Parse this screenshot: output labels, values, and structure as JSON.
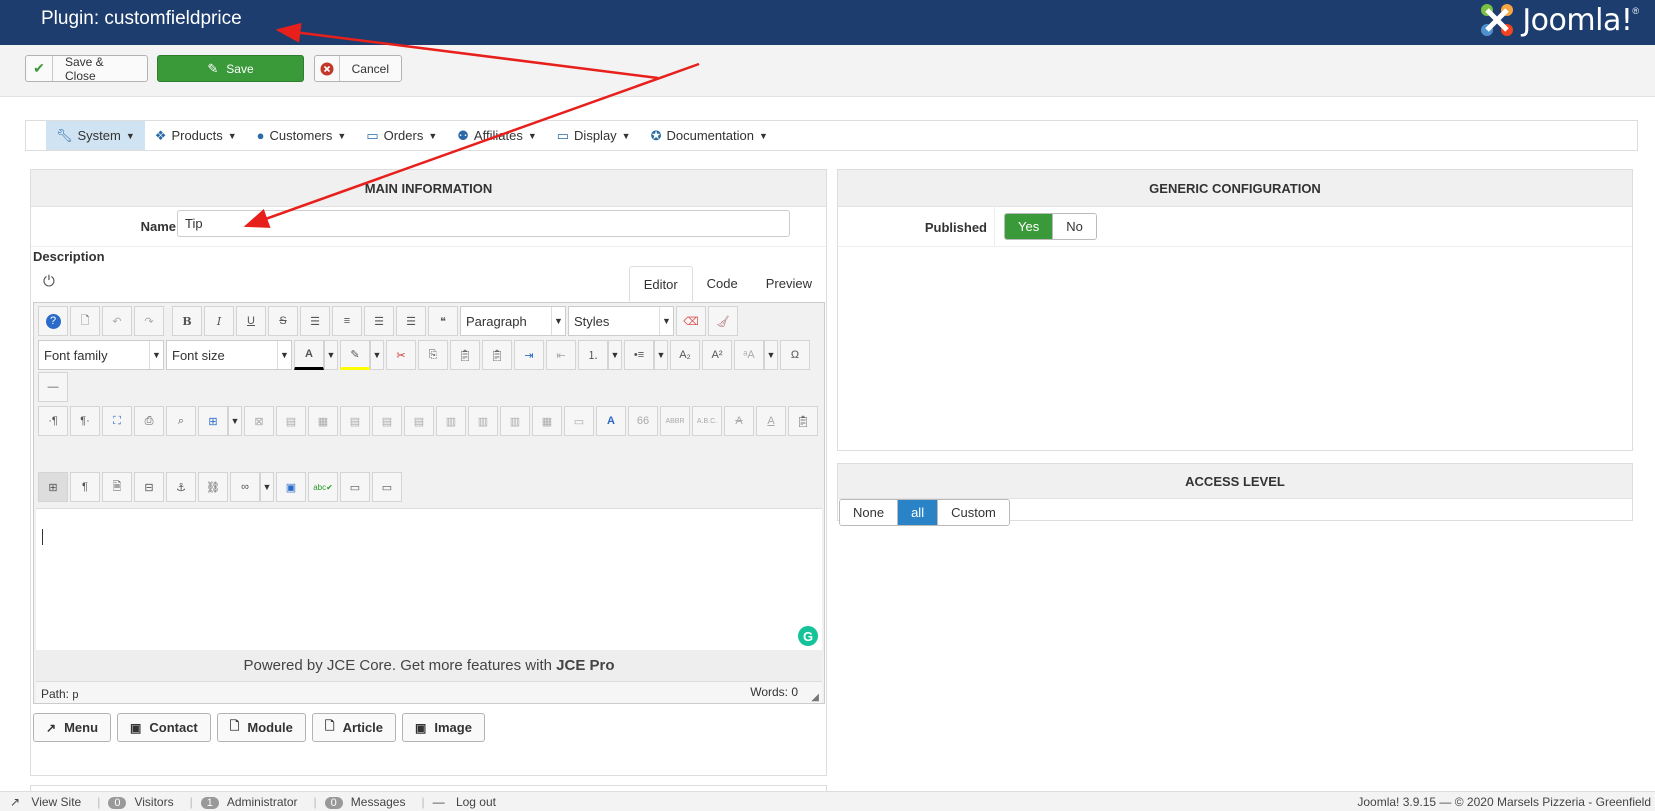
{
  "header": {
    "title": "Plugin: customfieldprice",
    "brand": "Joomla!",
    "brand_mark": "®"
  },
  "toolbar": {
    "save_close": "Save & Close",
    "save": "Save",
    "cancel": "Cancel"
  },
  "menu": [
    {
      "label": "System",
      "icon": "wrench-icon",
      "active": true
    },
    {
      "label": "Products",
      "icon": "cubes-icon"
    },
    {
      "label": "Customers",
      "icon": "user-icon"
    },
    {
      "label": "Orders",
      "icon": "credit-card-icon"
    },
    {
      "label": "Affiliates",
      "icon": "users-icon"
    },
    {
      "label": "Display",
      "icon": "monitor-icon"
    },
    {
      "label": "Documentation",
      "icon": "help-icon"
    }
  ],
  "main": {
    "heading": "MAIN INFORMATION",
    "name_label": "Name",
    "name_value": "Tip",
    "description_label": "Description",
    "tabs": [
      "Editor",
      "Code",
      "Preview"
    ],
    "editor": {
      "paragraph": "Paragraph",
      "styles": "Styles",
      "font_family": "Font family",
      "font_size": "Font size",
      "powered_text": "Powered by JCE Core. Get more features with",
      "powered_bold": "JCE Pro",
      "path_label": "Path:",
      "path_value": "p",
      "words": "Words: 0"
    },
    "extra_buttons": [
      "Menu",
      "Contact",
      "Module",
      "Article",
      "Image"
    ]
  },
  "generic": {
    "heading": "GENERIC CONFIGURATION",
    "published_label": "Published",
    "yes": "Yes",
    "no": "No"
  },
  "access": {
    "heading": "ACCESS LEVEL",
    "options": [
      "None",
      "all",
      "Custom"
    ]
  },
  "status": {
    "view_site": "View Site",
    "visitors_count": "0",
    "visitors": "Visitors",
    "admin_count": "1",
    "admin": "Administrator",
    "messages_count": "0",
    "messages": "Messages",
    "logout": "Log out",
    "footer": "Joomla! 3.9.15 — © 2020 Marsels Pizzeria - Greenfield"
  },
  "colors": {
    "header": "#1c3d6e",
    "save": "#3a9a3a",
    "active_blue": "#2a83c7",
    "annotation": "#e8201c"
  }
}
